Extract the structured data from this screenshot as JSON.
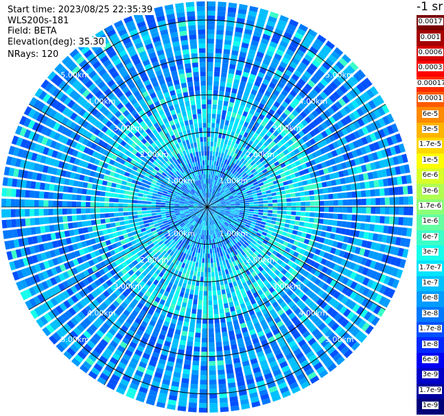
{
  "info": {
    "start_time": "Start time: 2023/08/25 22:35:39",
    "instrument": "WLS200s-181",
    "field": "Field: BETA",
    "elevation": "Elevation(deg): 35.30",
    "nrays": "NRays: 120"
  },
  "colorbar": {
    "title": "-1 sr",
    "labels": [
      "0.0017",
      "0.001",
      "0.0006",
      "0.0003",
      "0.00017",
      "0.0001",
      "6e-5",
      "3e-5",
      "1.7e-5",
      "1e-5",
      "6e-6",
      "3e-6",
      "1.7e-6",
      "1e-6",
      "6e-7",
      "3e-7",
      "1.7e-7",
      "1e-7",
      "6e-8",
      "3e-8",
      "1.7e-8",
      "1e-8",
      "6e-9",
      "3e-9",
      "1.7e-9",
      "1e-9"
    ],
    "colors": [
      "#7a0000",
      "#a50000",
      "#d40000",
      "#ff0000",
      "#ff2a00",
      "#ff5a00",
      "#ff8a00",
      "#ffb400",
      "#ffd800",
      "#ffff00",
      "#d8ff28",
      "#b0ff50",
      "#8cff78",
      "#64ffa0",
      "#3cffc8",
      "#14ffec",
      "#00e4ff",
      "#00c0ff",
      "#009cff",
      "#0078ff",
      "#0050ff",
      "#0028ff",
      "#0000f2",
      "#0000c8",
      "#00009e",
      "#000078"
    ]
  },
  "chart_data": {
    "type": "heatmap",
    "projection": "polar (PPI scan)",
    "field": "BETA",
    "units": "sr-1",
    "n_rays": 120,
    "elevation_deg": 35.3,
    "max_range_km": 5.5,
    "range_rings_km": [
      1,
      2,
      3,
      4,
      5
    ],
    "ring_labels": [
      "1.00km",
      "2.00km",
      "3.00km",
      "4.00km",
      "5.00km"
    ],
    "spoke_angles_deg": [
      0,
      30,
      60,
      90,
      120,
      150,
      180,
      210,
      240,
      270,
      300,
      330
    ],
    "value_pattern": [
      {
        "range_km": [
          0,
          1.5
        ],
        "dominant": "1.7e-8 to 1.7e-7"
      },
      {
        "range_km": [
          1.5,
          3.0
        ],
        "dominant": "1.7e-7 to 6e-7"
      },
      {
        "range_km": [
          3.0,
          5.5
        ],
        "dominant": "3e-8 to 1e-7"
      }
    ]
  }
}
